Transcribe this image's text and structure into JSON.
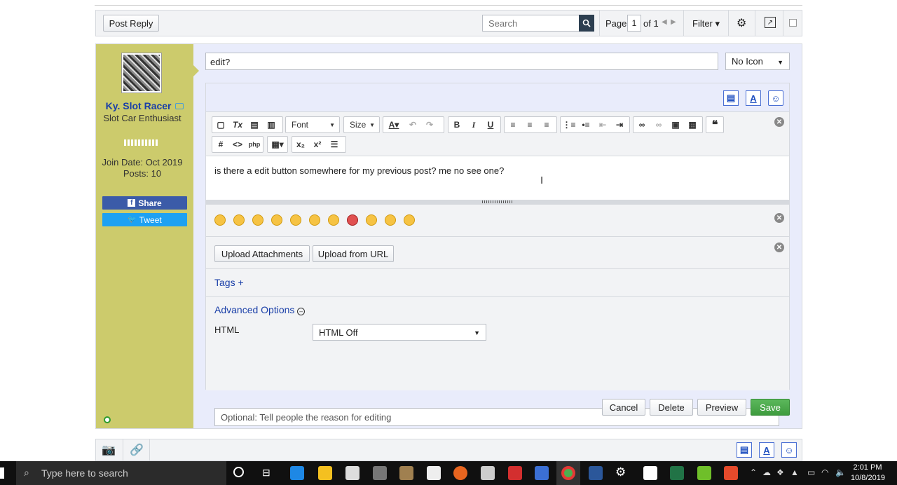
{
  "toolbar_top": {
    "post_reply": "Post Reply",
    "search_placeholder": "Search",
    "page_label": "Page",
    "page_value": "1",
    "page_of": "of 1",
    "filter_label": "Filter ▾"
  },
  "user": {
    "name": "Ky. Slot Racer",
    "title": "Slot Car Enthusiast",
    "join_date": "Join Date: Oct 2019",
    "posts": "Posts: 10",
    "share": "Share",
    "tweet": "Tweet"
  },
  "editor": {
    "title_value": "edit?",
    "icon_select": "No Icon",
    "font_label": "Font",
    "size_label": "Size",
    "body_text": "is there a edit button somewhere for my previous post? me no see one?",
    "upload_attachments": "Upload Attachments",
    "upload_url": "Upload from URL",
    "tags_label": "Tags +",
    "advanced_label": "Advanced Options",
    "html_label": "HTML",
    "html_select": "HTML Off",
    "reason_placeholder": "Optional: Tell people the reason for editing"
  },
  "actions": {
    "cancel": "Cancel",
    "delete": "Delete",
    "preview": "Preview",
    "save": "Save"
  },
  "taskbar": {
    "search_placeholder": "Type here to search",
    "time": "2:01 PM",
    "date": "10/8/2019"
  },
  "colors": {
    "user_pane": "#cccb6c",
    "save_green": "#3e9b3e",
    "link_blue": "#1a3fa8",
    "facebook": "#3b5ba8",
    "twitter": "#1da1f2"
  }
}
